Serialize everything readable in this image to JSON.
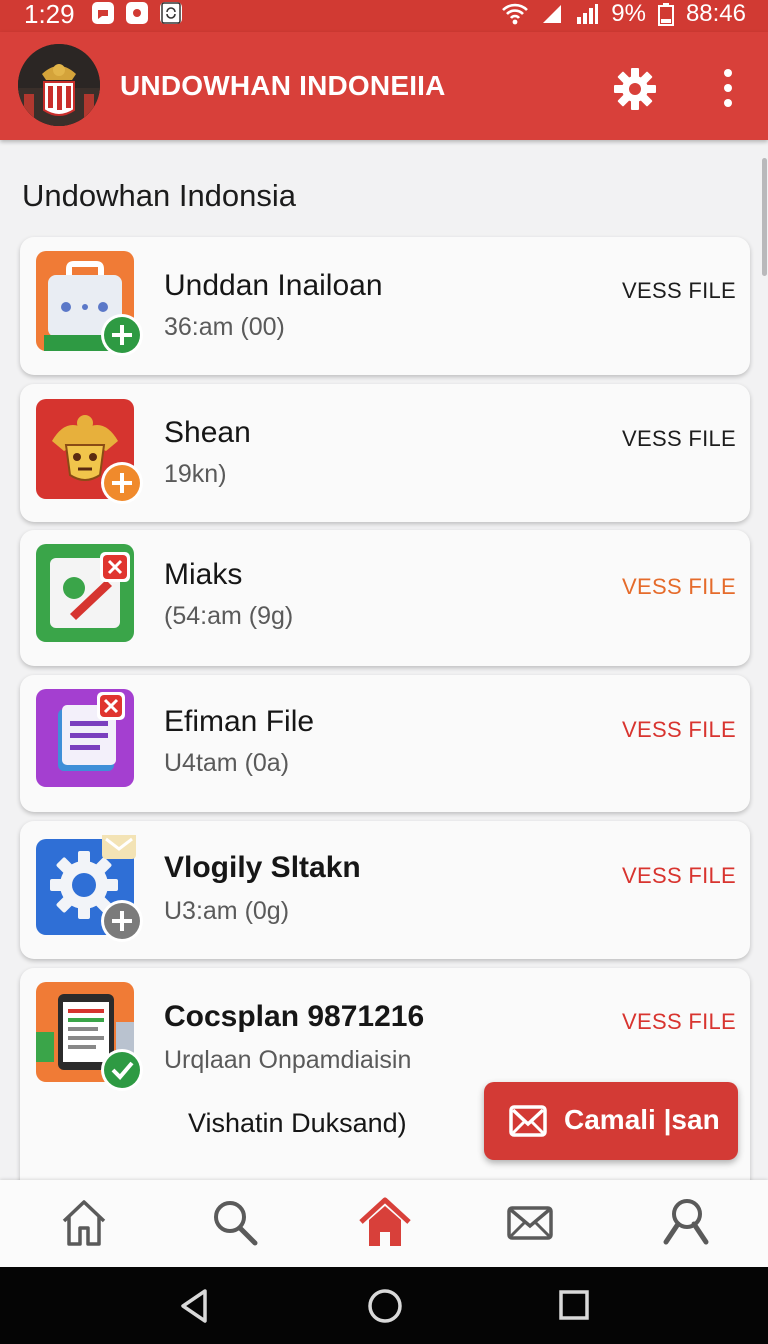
{
  "status_bar": {
    "time": "1:29",
    "battery": "9%",
    "clock_right": "88:46",
    "notification_icons": [
      "chat-icon",
      "circle-icon",
      "sync-icon"
    ]
  },
  "app_bar": {
    "title": "UNDOWHAN INDONEIIA",
    "logo_icon": "emblem-logo-icon",
    "settings_icon": "gear-icon",
    "menu_icon": "more-vert-icon"
  },
  "section_title": "Undowhan Indonsia",
  "items": [
    {
      "name": "Unddan Inailoan",
      "meta": "36:am (00)",
      "action": "VESS FILE",
      "action_color": "#1d1d1d",
      "icon": "briefcase-icon",
      "badge": "plus",
      "badge_color": "#2e9a43",
      "icon_bg": "#f07b36"
    },
    {
      "name": "Shean",
      "meta": "19kn)",
      "action": "VESS FILE",
      "action_color": "#1d1d1d",
      "icon": "garuda-emblem-icon",
      "badge": "plus",
      "badge_color": "#f08a2c",
      "icon_bg": "#d6342f"
    },
    {
      "name": "Miaks",
      "meta": "(54:am (9g)",
      "action": "VESS FILE",
      "action_color": "#e56b2b",
      "icon": "edit-card-icon",
      "badge": "close",
      "badge_color": "#e0352f",
      "icon_bg": "#3aa549"
    },
    {
      "name": "Efiman File",
      "meta": "U4tam (0a)",
      "action": "VESS FILE",
      "action_color": "#d8342f",
      "icon": "document-icon",
      "badge": "close",
      "badge_color": "#e0352f",
      "icon_bg": "#a43fd0"
    },
    {
      "name": "Vlogily Sltakn",
      "meta": "U3:am (0g)",
      "action": "VESS FILE",
      "action_color": "#d8342f",
      "icon": "settings-gear-icon",
      "badge": "plus",
      "badge_color": "#7b7b7b",
      "icon_bg": "#2f6fd6"
    },
    {
      "name": "Cocsplan 9871216",
      "meta": "Urqlaan Onpamdiaisin",
      "extra": "Vishatin Duksand)",
      "action": "VESS FILE",
      "action_color": "#d8342f",
      "icon": "tablet-document-icon",
      "badge": "check",
      "badge_color": "#2e9a43",
      "icon_bg": "#f07b36"
    }
  ],
  "fab": {
    "label": "Camali |san",
    "icon": "mail-icon",
    "color": "#d33a35"
  },
  "bottom_nav": [
    {
      "id": "home",
      "icon": "home-icon",
      "active": false
    },
    {
      "id": "search",
      "icon": "search-icon",
      "active": false
    },
    {
      "id": "home-active",
      "icon": "home-filled-icon",
      "active": true
    },
    {
      "id": "messages",
      "icon": "mail-icon",
      "active": false
    },
    {
      "id": "profile",
      "icon": "search-profile-icon",
      "active": false
    }
  ],
  "colors": {
    "primary": "#d8403a",
    "nav_active": "#d8403a",
    "nav_inactive": "#5a5a5a"
  }
}
